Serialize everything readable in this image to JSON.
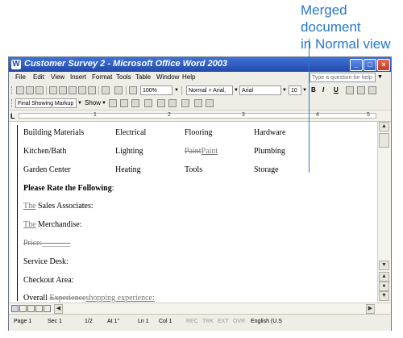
{
  "callout": {
    "line1": "Merged document",
    "line2": "in Normal view"
  },
  "window": {
    "title": "Customer Survey 2 - Microsoft Office Word 2003"
  },
  "menu": {
    "items": [
      {
        "label": "File"
      },
      {
        "label": "Edit"
      },
      {
        "label": "View"
      },
      {
        "label": "Insert"
      },
      {
        "label": "Format"
      },
      {
        "label": "Tools"
      },
      {
        "label": "Table"
      },
      {
        "label": "Window"
      },
      {
        "label": "Help"
      }
    ],
    "help_placeholder": "Type a question for help"
  },
  "standard_toolbar": {
    "zoom": "100%",
    "style": "Normal + Arial,",
    "font": "Arial",
    "font_size": "10",
    "bold": "B",
    "italic": "I",
    "underline": "U"
  },
  "reviewing_toolbar": {
    "display_mode": "Final Showing Markup",
    "show_label": "Show"
  },
  "ruler": {
    "numbers": [
      "1",
      "2",
      "3",
      "4",
      "5"
    ]
  },
  "document": {
    "grid_rows": [
      [
        "Building Materials",
        "Electrical",
        "Flooring",
        "Hardware"
      ],
      [
        "Kitchen/Bath",
        "Lighting",
        "",
        "Plumbing"
      ],
      [
        "Garden Center",
        "Heating",
        "Tools",
        "Storage"
      ]
    ],
    "paint_deleted": "Paint",
    "paint_inserted": "Paint",
    "rate_heading": "Please Rate the Following",
    "rate_colon": ":",
    "sales_the": "The",
    "sales_rest": " Sales Associates:",
    "merch_the": "The",
    "merch_rest": " Merchandise:",
    "price_deleted": "Price:",
    "price_blank": "_______",
    "service_desk": "Service Desk:",
    "checkout": "Checkout Area:",
    "overall_prefix": "Overall ",
    "overall_deleted": "Experience",
    "overall_inserted": "shopping experience",
    "overall_colon": ":"
  },
  "status": {
    "page": "Page  1",
    "sec": "Sec  1",
    "page_of": "1/2",
    "at": "At  1\"",
    "ln": "Ln  1",
    "col": "Col  1",
    "rec": "REC",
    "trk": "TRK",
    "ext": "EXT",
    "ovr": "OVR",
    "language": "English (U.S"
  },
  "colors": {
    "callout": "#2878c8",
    "titlebar": "#2b56b8",
    "markup": "#777777"
  }
}
